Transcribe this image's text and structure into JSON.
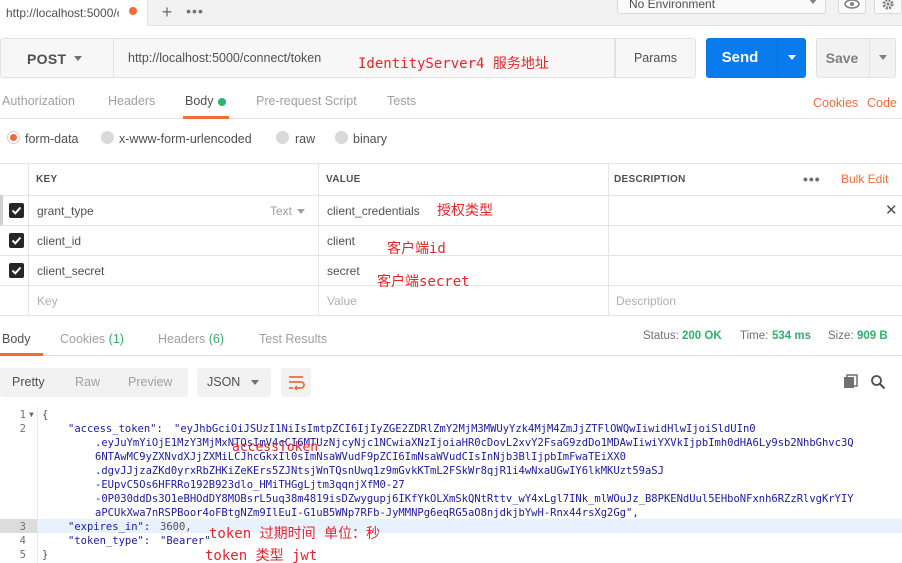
{
  "tab": {
    "title": "http://localhost:5000/c"
  },
  "env": {
    "selected": "No Environment"
  },
  "request": {
    "method": "POST",
    "url": "http://localhost:5000/connect/token",
    "params_label": "Params",
    "send_label": "Send",
    "save_label": "Save"
  },
  "annotations": {
    "server": "IdentityServer4 服务地址",
    "grant_type": "授权类型",
    "client_id": "客户端id",
    "client_secret": "客户端secret",
    "access_token": "accessToken",
    "expires": "token 过期时间 单位：秒",
    "token_type": "token 类型 jwt"
  },
  "request_tabs": [
    "Authorization",
    "Headers",
    "Body",
    "Pre-request Script",
    "Tests"
  ],
  "request_links": [
    "Cookies",
    "Code"
  ],
  "body_types": [
    "form-data",
    "x-www-form-urlencoded",
    "raw",
    "binary"
  ],
  "table": {
    "headers": [
      "KEY",
      "VALUE",
      "DESCRIPTION"
    ],
    "bulk_edit": "Bulk Edit",
    "type_label": "Text",
    "rows": [
      {
        "key": "grant_type",
        "value": "client_credentials",
        "checked": true
      },
      {
        "key": "client_id",
        "value": "client",
        "checked": true
      },
      {
        "key": "client_secret",
        "value": "secret",
        "checked": true
      }
    ],
    "placeholders": {
      "key": "Key",
      "value": "Value",
      "description": "Description"
    }
  },
  "response": {
    "tabs": {
      "body": "Body",
      "cookies": "Cookies",
      "cookies_count": "(1)",
      "headers": "Headers",
      "headers_count": "(6)",
      "tests": "Test Results"
    },
    "status_label": "Status:",
    "status": "200 OK",
    "time_label": "Time:",
    "time": "534 ms",
    "size_label": "Size:",
    "size": "909 B",
    "views": [
      "Pretty",
      "Raw",
      "Preview"
    ],
    "format": "JSON",
    "line_numbers": [
      "1",
      "2",
      "3",
      "4",
      "5"
    ],
    "lines": {
      "open": "{",
      "access_key": "\"access_token\": ",
      "access_val_1": "\"eyJhbGciOiJSUzI1NiIsImtpZCI6IjIyZGE2ZDRlZmY2MjM3MWUyYzk4MjM4ZmJjZTFlOWQwIiwidHlwIjoiSldUIn0",
      "access_val_2": ".eyJuYmYiOjE1MzY3MjMxNTQsImV4cCI6MTUzNjcyNjc1NCwiaXNzIjoiaHR0cDovL2xvY2FsaG9zdDo1MDAwIiwiYXVkIjpbImh0dHA6Ly9sb2NhbGhvc3Q",
      "access_val_3": "6NTAwMC9yZXNvdXJjZXMiLCJhcGkxIl0sImNsaWVudF9pZCI6ImNsaWVudCIsInNjb3BlIjpbImFwaTEiXX0",
      "access_val_4": ".dgvJJjzaZKd0yrxRbZHKiZeKErs5ZJNtsjWnTQsnUwq1z9mGvkKTmL2FSkWr8qjR1i4wNxaUGwIY6lkMKUzt59aSJ",
      "access_val_5": "-EUpvC5Os6HFRRo192B923dlo_HMiTHGgLjtm3qqnjXfM0-27",
      "access_val_6": "-0P030ddDs3O1eBHOdDY8MOBsrL5uq38m4819isDZwygupj6IKfYkOLXmSkQNtRttv_wY4xLgl7INk_mlWOuJz_B8PKENdUul5EHboNFxnh6RZzRlvgKrYIY",
      "access_val_7": "aPCUkXwa7nRSPBoor4oFBtgNZm9IlEuI-G1uB5WNp7RFb-JyMMNPg6eqRG5aO8njdkjbYwH-Rnx44rsXg2Gg\",",
      "expires_key": "\"expires_in\": ",
      "expires_val": "3600,",
      "type_key": "\"token_type\": ",
      "type_val": "\"Bearer\"",
      "close": "}"
    }
  },
  "colors": {
    "accent": "#f26b3a",
    "send": "#097bed",
    "success": "#2eb36a",
    "annotation": "#e8252b"
  },
  "icons": [
    "plus-icon",
    "more-icon",
    "chevron-down-icon",
    "eye-icon",
    "gear-icon",
    "checkbox-checked-icon",
    "close-icon",
    "wrap-icon",
    "copy-icon",
    "search-icon"
  ]
}
